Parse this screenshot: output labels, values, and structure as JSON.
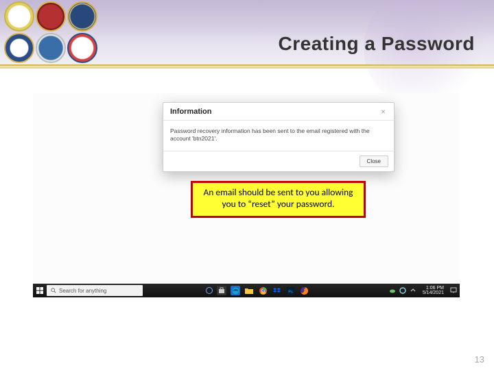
{
  "header": {
    "title": "Creating a Password",
    "seals": [
      "army",
      "marines",
      "navy",
      "dod",
      "af",
      "cg"
    ]
  },
  "modal": {
    "title": "Information",
    "body": "Password recovery information has been sent to the email registered with the account 'btn2021'.",
    "close_glyph": "×",
    "button_label": "Close"
  },
  "callout": {
    "text": "An email should be sent to you allowing you to “reset” your password."
  },
  "taskbar": {
    "search_placeholder": "Search for anything",
    "clock_time": "1:06 PM",
    "clock_date": "5/14/2021"
  },
  "slide_number": "13"
}
